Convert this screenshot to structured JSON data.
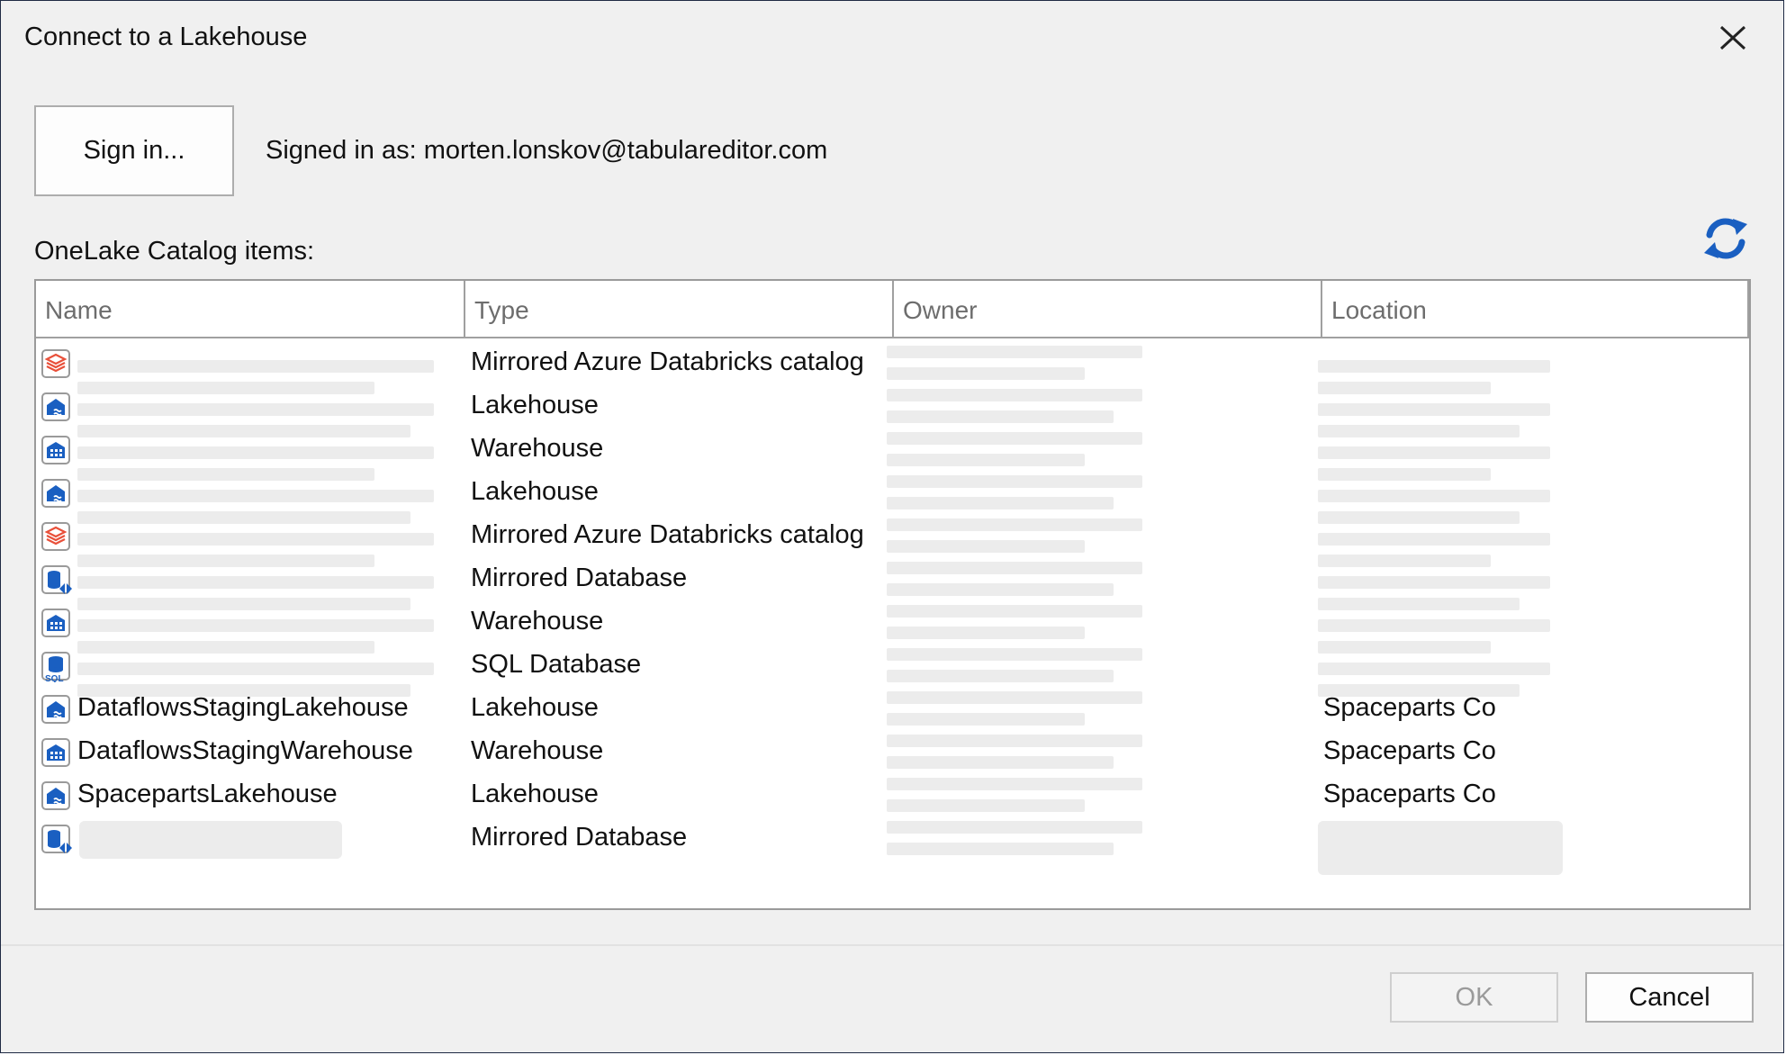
{
  "window": {
    "title": "Connect to a Lakehouse",
    "close_icon": "close-icon"
  },
  "signin": {
    "button_label": "Sign in...",
    "status_text": "Signed in as: morten.lonskov@tabulareditor.com"
  },
  "catalog": {
    "label": "OneLake Catalog items:",
    "refresh_icon": "refresh-icon",
    "columns": [
      "Name",
      "Type",
      "Owner",
      "Location"
    ],
    "rows": [
      {
        "icon": "databricks-icon",
        "name": "",
        "type": "Mirrored Azure Databricks catalog",
        "location": ""
      },
      {
        "icon": "lakehouse-icon",
        "name": "",
        "type": "Lakehouse",
        "location": ""
      },
      {
        "icon": "warehouse-icon",
        "name": "",
        "type": "Warehouse",
        "location": ""
      },
      {
        "icon": "lakehouse-icon",
        "name": "",
        "type": "Lakehouse",
        "location": ""
      },
      {
        "icon": "databricks-icon",
        "name": "",
        "type": "Mirrored Azure Databricks catalog",
        "location": ""
      },
      {
        "icon": "mirrored-database-icon",
        "name": "",
        "type": "Mirrored Database",
        "location": ""
      },
      {
        "icon": "warehouse-icon",
        "name": "",
        "type": "Warehouse",
        "location": ""
      },
      {
        "icon": "sql-database-icon",
        "name": "",
        "type": "SQL Database",
        "location": ""
      },
      {
        "icon": "lakehouse-icon",
        "name": "DataflowsStagingLakehouse",
        "type": "Lakehouse",
        "location": "Spaceparts Co"
      },
      {
        "icon": "warehouse-icon",
        "name": "DataflowsStagingWarehouse",
        "type": "Warehouse",
        "location": "Spaceparts Co"
      },
      {
        "icon": "lakehouse-icon",
        "name": "SpacepartsLakehouse",
        "type": "Lakehouse",
        "location": "Spaceparts Co"
      },
      {
        "icon": "mirrored-database-icon",
        "name": "",
        "type": "Mirrored Database",
        "location": ""
      }
    ]
  },
  "footer": {
    "ok_label": "OK",
    "cancel_label": "Cancel"
  },
  "colors": {
    "accent": "#1a5fc1",
    "databricks": "#e8503a",
    "dialog_bg": "#f0f0f0"
  }
}
